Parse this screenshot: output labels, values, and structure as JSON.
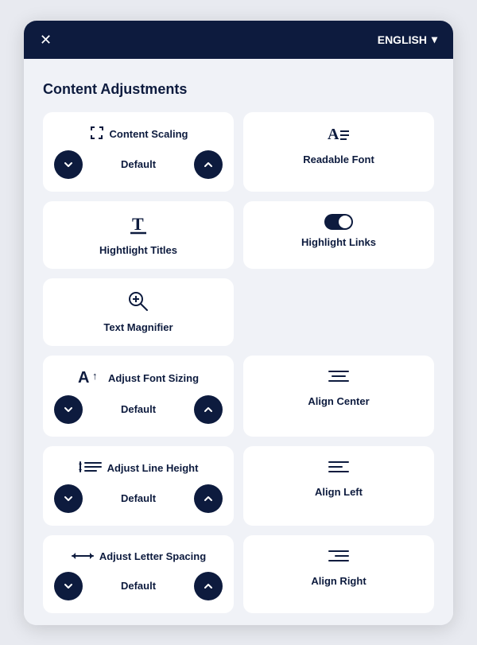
{
  "topbar": {
    "close_label": "✕",
    "language_label": "ENGLISH",
    "chevron": "▾"
  },
  "section": {
    "title": "Content Adjustments"
  },
  "cards": {
    "content_scaling": {
      "label": "Content Scaling",
      "value": "Default",
      "icon": "⤢"
    },
    "readable_font": {
      "label": "Readable Font",
      "icon": "A≡"
    },
    "highlight_titles": {
      "label": "Hightlight Titles",
      "icon": "T"
    },
    "highlight_links": {
      "label": "Highlight Links"
    },
    "text_magnifier": {
      "label": "Text Magnifier",
      "icon": "⊕"
    },
    "adjust_font_sizing": {
      "label": "Adjust Font Sizing",
      "value": "Default",
      "icon": "A↕"
    },
    "align_center": {
      "label": "Align Center",
      "icon": "≡"
    },
    "adjust_line_height": {
      "label": "Adjust Line Height",
      "value": "Default",
      "icon": "↕≡"
    },
    "align_left": {
      "label": "Align Left",
      "icon": "≡"
    },
    "adjust_letter_spacing": {
      "label": "Adjust Letter Spacing",
      "value": "Default",
      "icon": "↔"
    },
    "align_right": {
      "label": "Align Right",
      "icon": "≡"
    }
  },
  "stepper": {
    "down_label": "",
    "up_label": ""
  }
}
